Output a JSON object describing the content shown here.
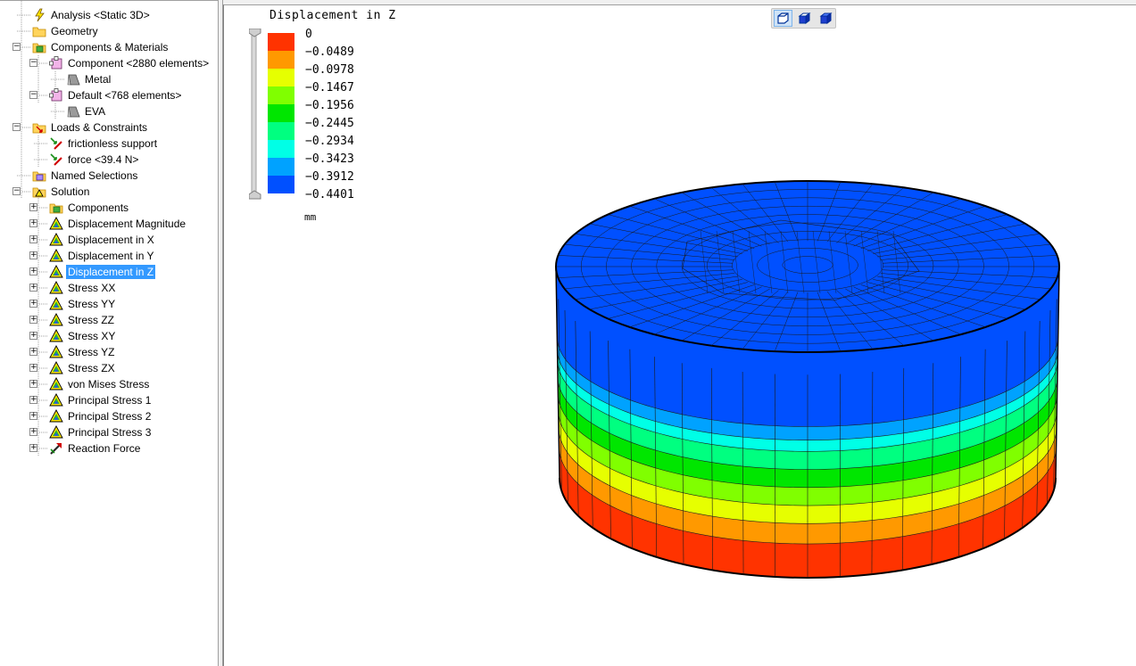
{
  "tree": {
    "items": [
      {
        "label": "Analysis <Static 3D>",
        "icon": "analysis-icon"
      },
      {
        "label": "Geometry",
        "icon": "folder-icon"
      },
      {
        "label": "Components & Materials",
        "icon": "components-icon"
      },
      {
        "label": "Component <2880 elements>",
        "icon": "component-part-icon"
      },
      {
        "label": "Metal",
        "icon": "material-icon"
      },
      {
        "label": "Default <768 elements>",
        "icon": "component-part-icon"
      },
      {
        "label": "EVA",
        "icon": "material-icon"
      },
      {
        "label": "Loads & Constraints",
        "icon": "loads-icon"
      },
      {
        "label": "frictionless support",
        "icon": "constraint-icon"
      },
      {
        "label": "force <39.4 N>",
        "icon": "constraint-icon"
      },
      {
        "label": "Named Selections",
        "icon": "named-selections-icon"
      },
      {
        "label": "Solution",
        "icon": "solution-icon"
      },
      {
        "label": "Components",
        "icon": "components-icon"
      },
      {
        "label": "Displacement Magnitude",
        "icon": "result-icon"
      },
      {
        "label": "Displacement in X",
        "icon": "result-icon"
      },
      {
        "label": "Displacement in Y",
        "icon": "result-icon"
      },
      {
        "label": "Displacement in Z",
        "icon": "result-icon",
        "selected": true
      },
      {
        "label": "Stress XX",
        "icon": "result-icon"
      },
      {
        "label": "Stress YY",
        "icon": "result-icon"
      },
      {
        "label": "Stress ZZ",
        "icon": "result-icon"
      },
      {
        "label": "Stress XY",
        "icon": "result-icon"
      },
      {
        "label": "Stress YZ",
        "icon": "result-icon"
      },
      {
        "label": "Stress ZX",
        "icon": "result-icon"
      },
      {
        "label": "von Mises Stress",
        "icon": "result-icon"
      },
      {
        "label": "Principal Stress 1",
        "icon": "result-icon"
      },
      {
        "label": "Principal Stress 2",
        "icon": "result-icon"
      },
      {
        "label": "Principal Stress 3",
        "icon": "result-icon"
      },
      {
        "label": "Reaction Force",
        "icon": "reaction-force-icon"
      }
    ]
  },
  "legend": {
    "title": "Displacement in Z",
    "unit": "mm",
    "values": [
      "0",
      "-0.0489",
      "-0.0978",
      "-0.1467",
      "-0.1956",
      "-0.2445",
      "-0.2934",
      "-0.3423",
      "-0.3912",
      "-0.4401"
    ],
    "colors": [
      "#ff3300",
      "#ff9900",
      "#e6ff00",
      "#80ff00",
      "#00e600",
      "#00ff80",
      "#00ffe6",
      "#00a2ff",
      "#0050ff"
    ]
  },
  "toolbar": {
    "buttons": [
      "view-box-wireframe-icon",
      "view-box-shaded-icon",
      "view-box-solid-icon"
    ]
  }
}
